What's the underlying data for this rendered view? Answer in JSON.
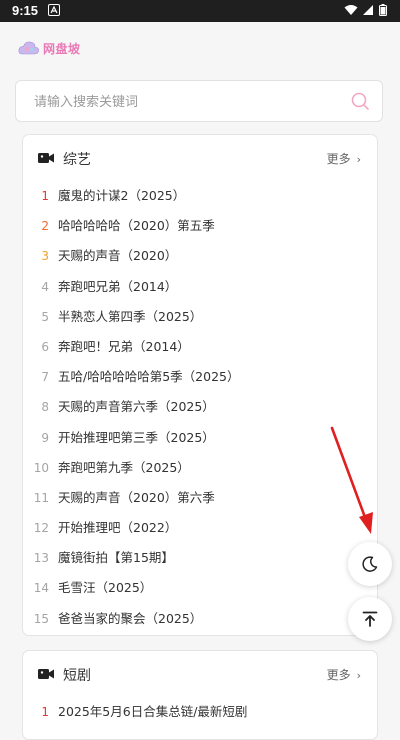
{
  "status_bar": {
    "time": "9:15",
    "icons": [
      "notification-a-icon",
      "wifi-icon",
      "signal-icon",
      "battery-icon"
    ]
  },
  "logo": {
    "text": "网盘坡",
    "icon": "cloud-logo-icon",
    "color": "#e97ab6"
  },
  "search": {
    "placeholder": "请输入搜索关键词",
    "icon": "search-icon",
    "icon_color": "#f2a8c4"
  },
  "sections": [
    {
      "title": "综艺",
      "icon": "video-camera-icon",
      "more_label": "更多",
      "items": [
        {
          "rank": "1",
          "title": "魔鬼的计谋2（2025）"
        },
        {
          "rank": "2",
          "title": "哈哈哈哈哈（2020）第五季"
        },
        {
          "rank": "3",
          "title": "天赐的声音（2020）"
        },
        {
          "rank": "4",
          "title": "奔跑吧兄弟（2014）"
        },
        {
          "rank": "5",
          "title": "半熟恋人第四季（2025）"
        },
        {
          "rank": "6",
          "title": "奔跑吧！兄弟（2014）"
        },
        {
          "rank": "7",
          "title": "五哈/哈哈哈哈哈第5季（2025）"
        },
        {
          "rank": "8",
          "title": "天赐的声音第六季（2025）"
        },
        {
          "rank": "9",
          "title": "开始推理吧第三季（2025）"
        },
        {
          "rank": "10",
          "title": "奔跑吧第九季（2025）"
        },
        {
          "rank": "11",
          "title": "天赐的声音（2020）第六季"
        },
        {
          "rank": "12",
          "title": "开始推理吧（2022）"
        },
        {
          "rank": "13",
          "title": "魔镜街拍【第15期】"
        },
        {
          "rank": "14",
          "title": "毛雪汪（2025）"
        },
        {
          "rank": "15",
          "title": "爸爸当家的聚会（2025）"
        }
      ]
    },
    {
      "title": "短剧",
      "icon": "video-camera-icon",
      "more_label": "更多",
      "items": [
        {
          "rank": "1",
          "title": "2025年5月6日合集总链/最新短剧"
        }
      ]
    }
  ],
  "floating_buttons": [
    {
      "icon": "moon-icon"
    },
    {
      "icon": "back-to-top-icon"
    }
  ],
  "colors": {
    "rank1": "#e53935",
    "rank2": "#ef6c2f",
    "rank3": "#f0a02a",
    "rank_other": "#a5a5a5",
    "annotation_arrow": "#e02020"
  }
}
